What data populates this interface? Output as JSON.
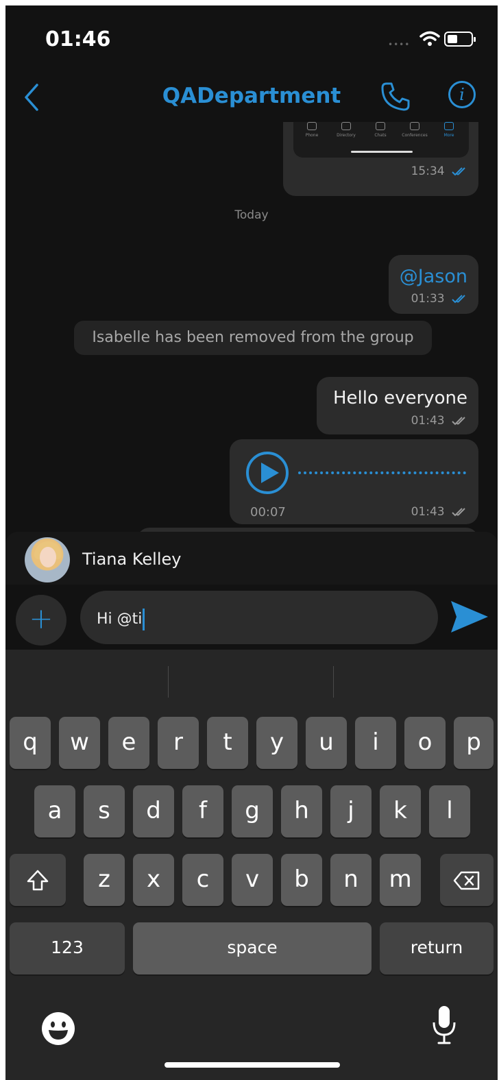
{
  "status": {
    "time": "01:46",
    "signal": "••••"
  },
  "header": {
    "title": "QADepartment",
    "info_label": "i"
  },
  "colors": {
    "accent": "#2a8fd4",
    "background": "#121212",
    "bubble": "#2c2c2c"
  },
  "screenshot_msg": {
    "tabs": [
      "Phone",
      "Directory",
      "Chats",
      "Conferences",
      "More"
    ],
    "time": "15:34"
  },
  "day_separator": "Today",
  "messages": {
    "mention": {
      "text": "@Jason",
      "time": "01:33"
    },
    "system": "Isabelle has been removed from the group",
    "hello": {
      "text": "Hello everyone",
      "time": "01:43"
    },
    "voice": {
      "duration": "00:07",
      "time": "01:43"
    }
  },
  "suggestion": {
    "name": "Tiana Kelley"
  },
  "composer": {
    "plus": "+",
    "text": "Hi @ti"
  },
  "keyboard": {
    "row1": [
      "q",
      "w",
      "e",
      "r",
      "t",
      "y",
      "u",
      "i",
      "o",
      "p"
    ],
    "row2": [
      "a",
      "s",
      "d",
      "f",
      "g",
      "h",
      "j",
      "k",
      "l"
    ],
    "row3": [
      "z",
      "x",
      "c",
      "v",
      "b",
      "n",
      "m"
    ],
    "numbers": "123",
    "space": "space",
    "return": "return"
  },
  "icons": {
    "back": "chevron-left-icon",
    "call": "phone-icon",
    "info": "info-icon",
    "send": "send-icon",
    "shift": "shift-icon",
    "delete": "backspace-icon",
    "emoji": "emoji-icon",
    "mic": "microphone-icon"
  }
}
